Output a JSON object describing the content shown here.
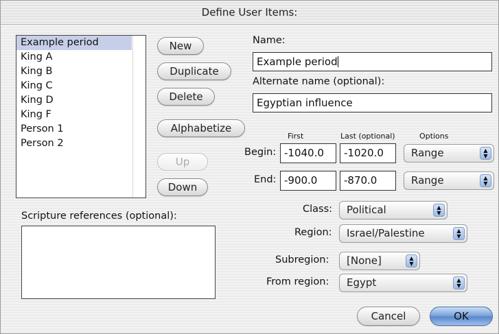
{
  "window": {
    "title": "Define User Items:"
  },
  "list": {
    "items": [
      "Example period",
      "King A",
      "King B",
      "King C",
      "King D",
      "King F",
      "Person 1",
      "Person 2"
    ],
    "selected_index": 0
  },
  "buttons": {
    "new": "New",
    "duplicate": "Duplicate",
    "delete": "Delete",
    "alphabetize": "Alphabetize",
    "up": "Up",
    "down": "Down",
    "cancel": "Cancel",
    "ok": "OK"
  },
  "name": {
    "label": "Name:",
    "value": "Example period"
  },
  "alternate": {
    "label": "Alternate name (optional):",
    "value": "Egyptian influence"
  },
  "columns": {
    "first": "First",
    "last": "Last (optional)",
    "options": "Options"
  },
  "begin": {
    "label": "Begin:",
    "first": "-1040.0",
    "last": "-1020.0",
    "option": "Range"
  },
  "end": {
    "label": "End:",
    "first": "-900.0",
    "last": "-870.0",
    "option": "Range"
  },
  "class": {
    "label": "Class:",
    "value": "Political"
  },
  "region": {
    "label": "Region:",
    "value": "Israel/Palestine"
  },
  "subregion": {
    "label": "Subregion:",
    "value": "[None]"
  },
  "from_region": {
    "label": "From region:",
    "value": "Egypt"
  },
  "scripture": {
    "label": "Scripture references (optional):",
    "value": ""
  },
  "icons": {
    "popup_arrows": "updown-arrows-icon"
  }
}
